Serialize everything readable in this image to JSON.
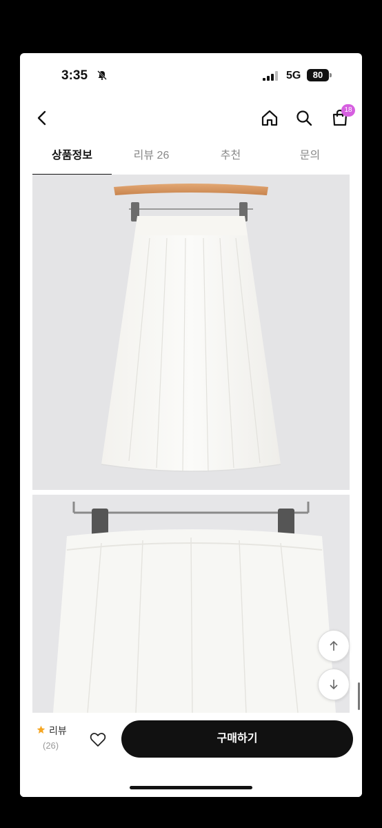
{
  "status_bar": {
    "time": "3:35",
    "network": "5G",
    "battery": "80"
  },
  "header": {
    "cart_badge": "18"
  },
  "tabs": [
    {
      "label": "상품정보",
      "active": true
    },
    {
      "label": "리뷰 26",
      "active": false
    },
    {
      "label": "추천",
      "active": false
    },
    {
      "label": "문의",
      "active": false
    }
  ],
  "product_images": [
    {
      "name": "product-image-skirt-full"
    },
    {
      "name": "product-image-skirt-detail"
    }
  ],
  "bottom_bar": {
    "review_label": "리뷰",
    "review_count": "(26)",
    "buy_label": "구매하기"
  },
  "icons": {
    "back": "chevron-left-icon",
    "home": "home-icon",
    "search": "search-icon",
    "cart": "shopping-bag-icon",
    "wishlist": "heart-icon",
    "scroll_up": "arrow-up-icon",
    "scroll_down": "arrow-down-icon",
    "review_star": "star-icon"
  },
  "colors": {
    "accent_badge": "#d65fe0",
    "buy_button": "#111111",
    "star": "#f5a623"
  }
}
